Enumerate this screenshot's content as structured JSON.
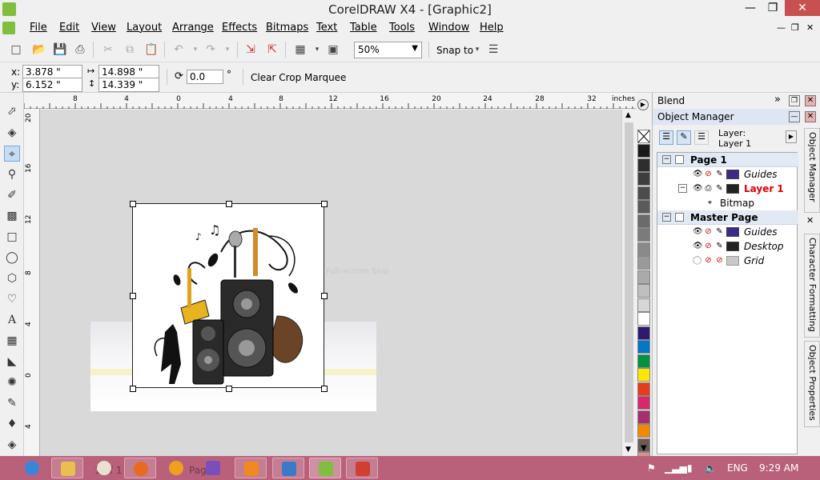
{
  "window": {
    "title": "CorelDRAW X4 - [Graphic2]"
  },
  "menu": [
    "File",
    "Edit",
    "View",
    "Layout",
    "Arrange",
    "Effects",
    "Bitmaps",
    "Text",
    "Table",
    "Tools",
    "Window",
    "Help"
  ],
  "toolbar": {
    "zoom": "50%",
    "snap_to": "Snap to"
  },
  "property_bar": {
    "x_label": "x:",
    "x_value": "3.878 \"",
    "y_label": "y:",
    "y_value": "6.152 \"",
    "width_value": "14.898 \"",
    "height_value": "14.339 \"",
    "rotation_value": "0.0",
    "rotation_unit": "°",
    "clear_crop": "Clear Crop Marquee"
  },
  "ruler": {
    "units": "inches",
    "h_ticks": [
      "8",
      "4",
      "0",
      "4",
      "8",
      "12",
      "16",
      "20",
      "24",
      "28",
      "32"
    ],
    "v_ticks": [
      "20",
      "16",
      "12",
      "8",
      "4",
      "0",
      "4"
    ]
  },
  "canvas": {
    "watermark": "Full-screen Snip"
  },
  "docker": {
    "blend_title": "Blend",
    "om_title": "Object Manager",
    "layer_label": "Layer:",
    "layer_value": "Layer 1",
    "tree": {
      "page1": "Page 1",
      "guides1": "Guides",
      "layer1": "Layer 1",
      "bitmap": "Bitmap",
      "master": "Master Page",
      "guides2": "Guides",
      "desktop": "Desktop",
      "grid": "Grid"
    },
    "tabs": [
      "Object Manager",
      "Character Formatting",
      "Object Properties"
    ]
  },
  "taskbar": {
    "language": "ENG",
    "time": "9:29 AM",
    "behind_text_1": "1 of 1",
    "behind_text_2": "Page"
  },
  "colors": {
    "taskbar": "#b9617a",
    "palette": [
      "#1a1a1a",
      "#2e2e2e",
      "#3d3d3d",
      "#4c4c4c",
      "#5b5b5b",
      "#6b6b6b",
      "#7b7b7b",
      "#8a8a8a",
      "#9a9a9a",
      "#aaaaaa",
      "#bfbfbf",
      "#d6d6d6",
      "#ffffff",
      "#2e1a6e",
      "#0077c8",
      "#00923f",
      "#ffe600",
      "#e63c1c",
      "#d8276b",
      "#a6306d",
      "#f08a00",
      "#6b5a56",
      "#d9908a",
      "#b3a7cf"
    ]
  }
}
